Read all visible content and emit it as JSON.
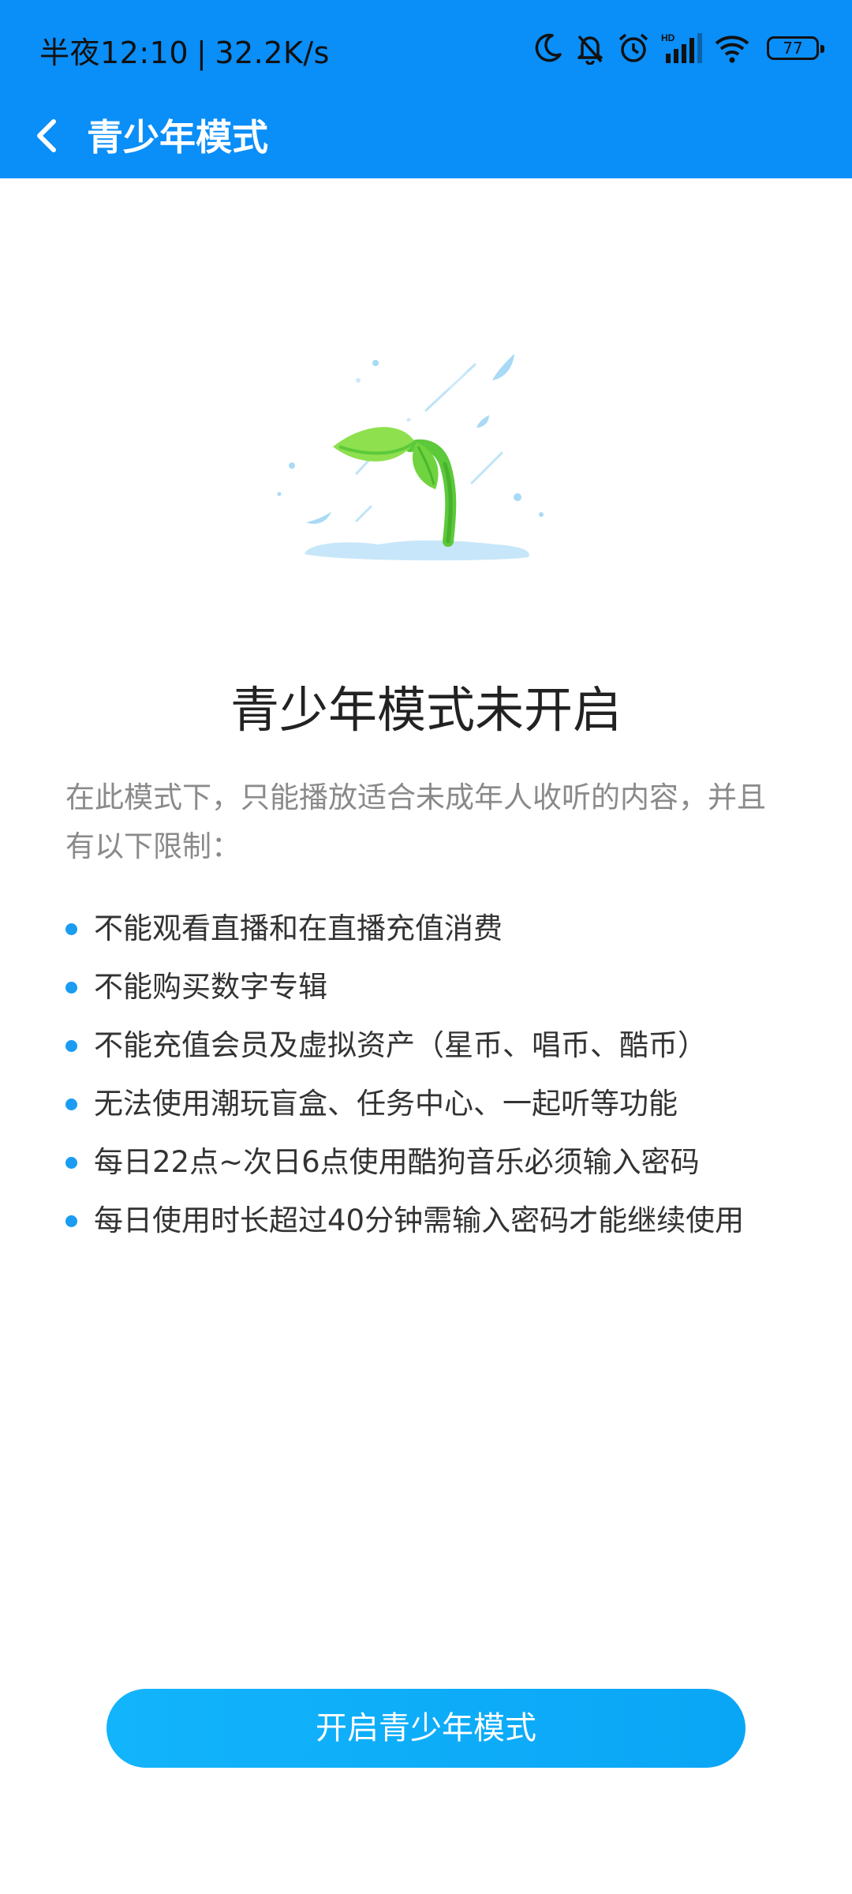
{
  "status_bar": {
    "time": "半夜12:10",
    "separator": "|",
    "network_speed": "32.2K/s",
    "battery_level": "77",
    "icons": [
      "moon-icon",
      "bell-off-icon",
      "alarm-icon",
      "hd-signal-icon",
      "wifi-icon",
      "battery-icon"
    ]
  },
  "nav": {
    "back_icon": "chevron-left-icon",
    "title": "青少年模式"
  },
  "illustration": {
    "icon": "sprout-in-rain-illustration"
  },
  "main": {
    "title": "青少年模式未开启",
    "description": "在此模式下，只能播放适合未成年人收听的内容，并且有以下限制：",
    "restrictions": [
      "不能观看直播和在直播充值消费",
      "不能购买数字专辑",
      "不能充值会员及虚拟资产（星币、唱币、酷币）",
      "无法使用潮玩盲盒、任务中心、一起听等功能",
      "每日22点~次日6点使用酷狗音乐必须输入密码",
      "每日使用时长超过40分钟需输入密码才能继续使用"
    ]
  },
  "action": {
    "enable_button_label": "开启青少年模式"
  },
  "colors": {
    "header_bg": "#0a8ef8",
    "accent": "#1a9cf2",
    "button_bg": "#12b4fb",
    "sprout_green": "#5cc93a",
    "rain_blue": "#a8daf6"
  }
}
